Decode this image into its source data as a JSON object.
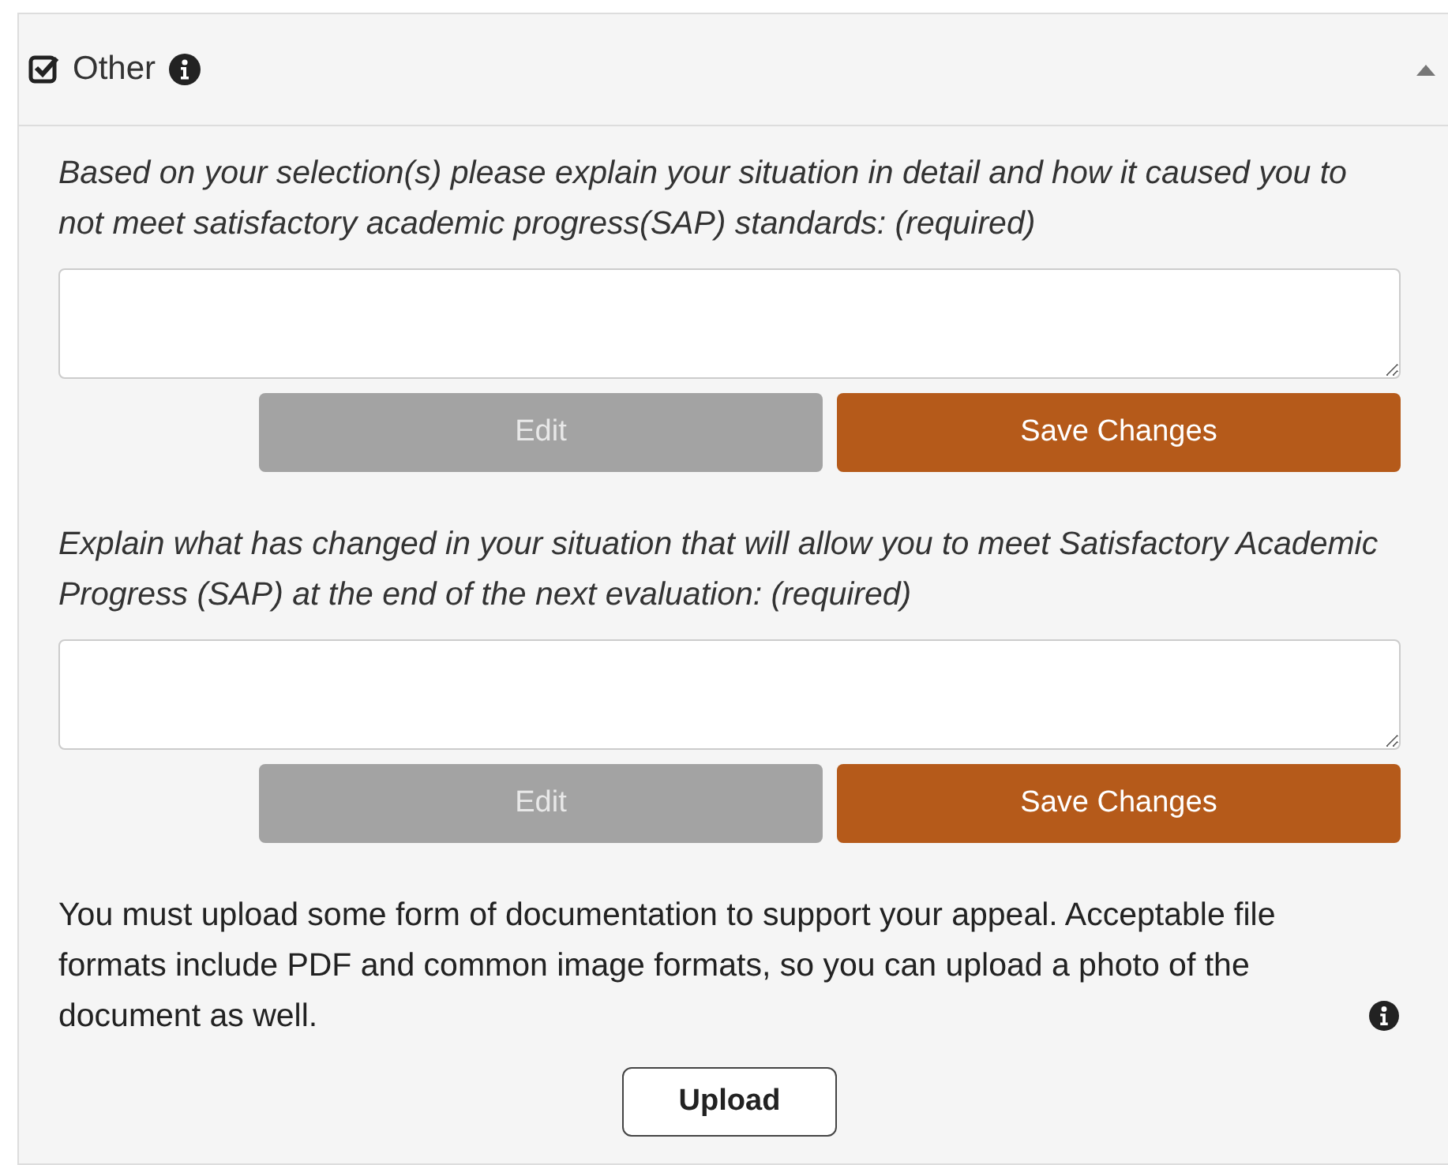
{
  "panel": {
    "title": "Other",
    "checked": true,
    "expanded": true
  },
  "questions": [
    {
      "prompt": "Based on your selection(s) please explain your situation in detail and how it caused you to not meet satisfactory academic progress(SAP) standards: (required)",
      "edit": {
        "label": "Edit",
        "disabled": true
      },
      "save": {
        "label": "Save Changes"
      }
    },
    {
      "prompt": "Explain what has changed in your situation that will allow you to meet Satisfactory Academic Progress (SAP) at the end of the next evaluation: (required)",
      "edit": {
        "label": "Edit",
        "disabled": true
      },
      "save": {
        "label": "Save Changes"
      }
    }
  ],
  "upload": {
    "note": "You must upload some form of documentation to support your appeal. Acceptable file formats include PDF and common image formats, so you can upload a photo of the document as well.",
    "button": "Upload"
  }
}
